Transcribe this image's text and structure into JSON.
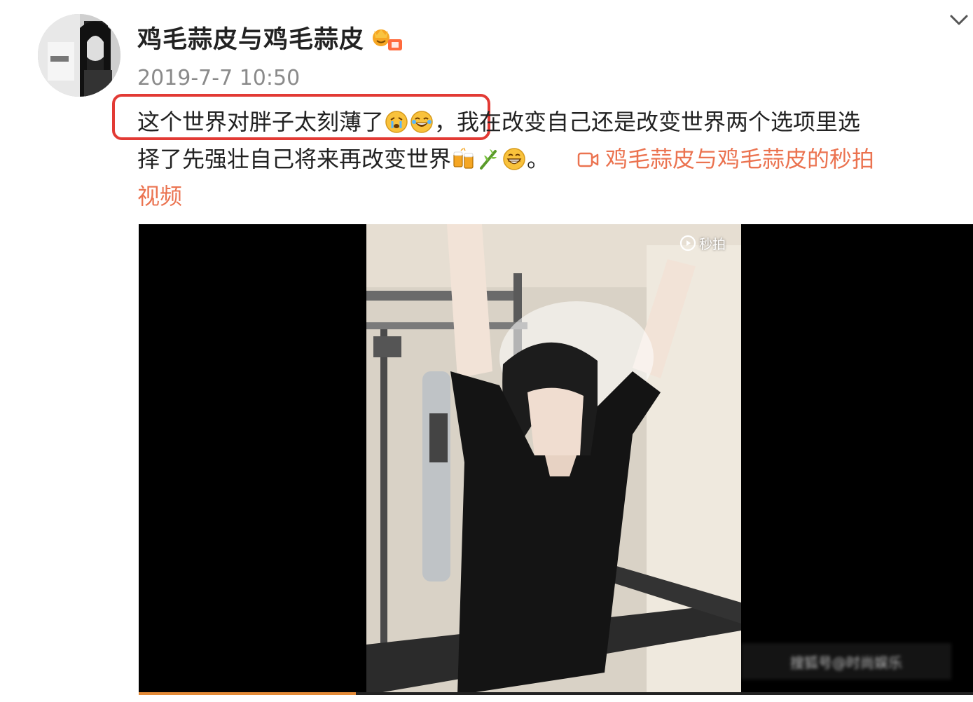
{
  "post": {
    "author": "鸡毛蒜皮与鸡毛蒜皮",
    "timestamp": "2019-7-7 10:50",
    "text": {
      "highlighted": "这个世界对胖子太刻薄了",
      "comma": "，",
      "line1_rest": "我在改变自己还是改变世界两个选项里选",
      "line2": "择了先强壮自己将来再改变世界",
      "period": "。",
      "link_part1": "鸡毛蒜皮与鸡毛蒜皮的秒拍",
      "link_part2": "视频"
    },
    "emojis": [
      "crying-emoji",
      "laughing-tears-emoji",
      "cheers-beer-emoji",
      "bamboo-emoji",
      "grin-emoji"
    ],
    "colors": {
      "highlight_border": "#e23a34",
      "link": "#eb7350",
      "timestamp": "#8a8a8a"
    }
  },
  "video": {
    "brand": "秒拍",
    "watermark": "搜狐号@时尚娱乐",
    "progress": 0.26
  },
  "icons": {
    "menu": "chevron-down-icon",
    "badge": "vip-badge-icon",
    "video_link": "video-camera-icon"
  }
}
